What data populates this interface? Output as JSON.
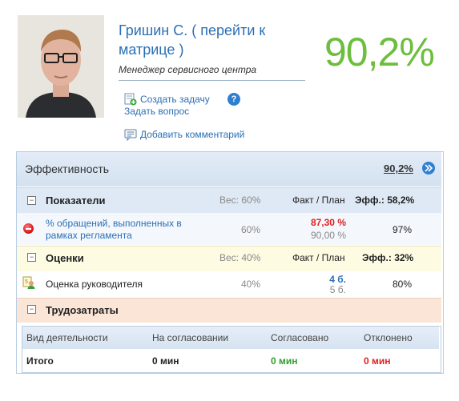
{
  "profile": {
    "name": "Гришин С.",
    "open_paren": "(",
    "go_to_matrix": "перейти к матрице",
    "close_paren": ")",
    "role": "Менеджер сервисного центра",
    "score": "90,2%"
  },
  "actions": {
    "create_task": "Создать задачу",
    "ask_question": "Задать вопрос",
    "add_comment": "Добавить комментарий",
    "help": "?"
  },
  "effectiveness": {
    "title": "Эффективность",
    "value": "90,2%"
  },
  "indicators": {
    "title": "Показатели",
    "weight": "Вес: 60%",
    "fact_plan_header": "Факт / План",
    "eff": "Эфф.: 58,2%",
    "rows": [
      {
        "label_line1": "% обращений, выполненных в",
        "label_line2": "рамках регламента",
        "weight": "60%",
        "fact": "87,30 %",
        "plan": "90,00 %",
        "eff": "97%"
      }
    ]
  },
  "ratings": {
    "title": "Оценки",
    "weight": "Вес: 40%",
    "fact_plan_header": "Факт / План",
    "eff": "Эфф.: 32%",
    "rows": [
      {
        "label": "Оценка руководителя",
        "weight": "40%",
        "fact": "4 б.",
        "plan": "5 б.",
        "eff": "80%"
      }
    ]
  },
  "labor": {
    "title": "Трудозатраты",
    "columns": [
      "Вид деятельности",
      "На согласовании",
      "Согласовано",
      "Отклонено"
    ],
    "total": {
      "label": "Итого",
      "pending": "0 мин",
      "approved": "0 мин",
      "rejected": "0 мин"
    }
  },
  "colors": {
    "score": "#6cbe3c",
    "link": "#2b6fb4",
    "fact_bad": "#e02020",
    "approved": "#2f9e2f",
    "rejected": "#e02020"
  }
}
